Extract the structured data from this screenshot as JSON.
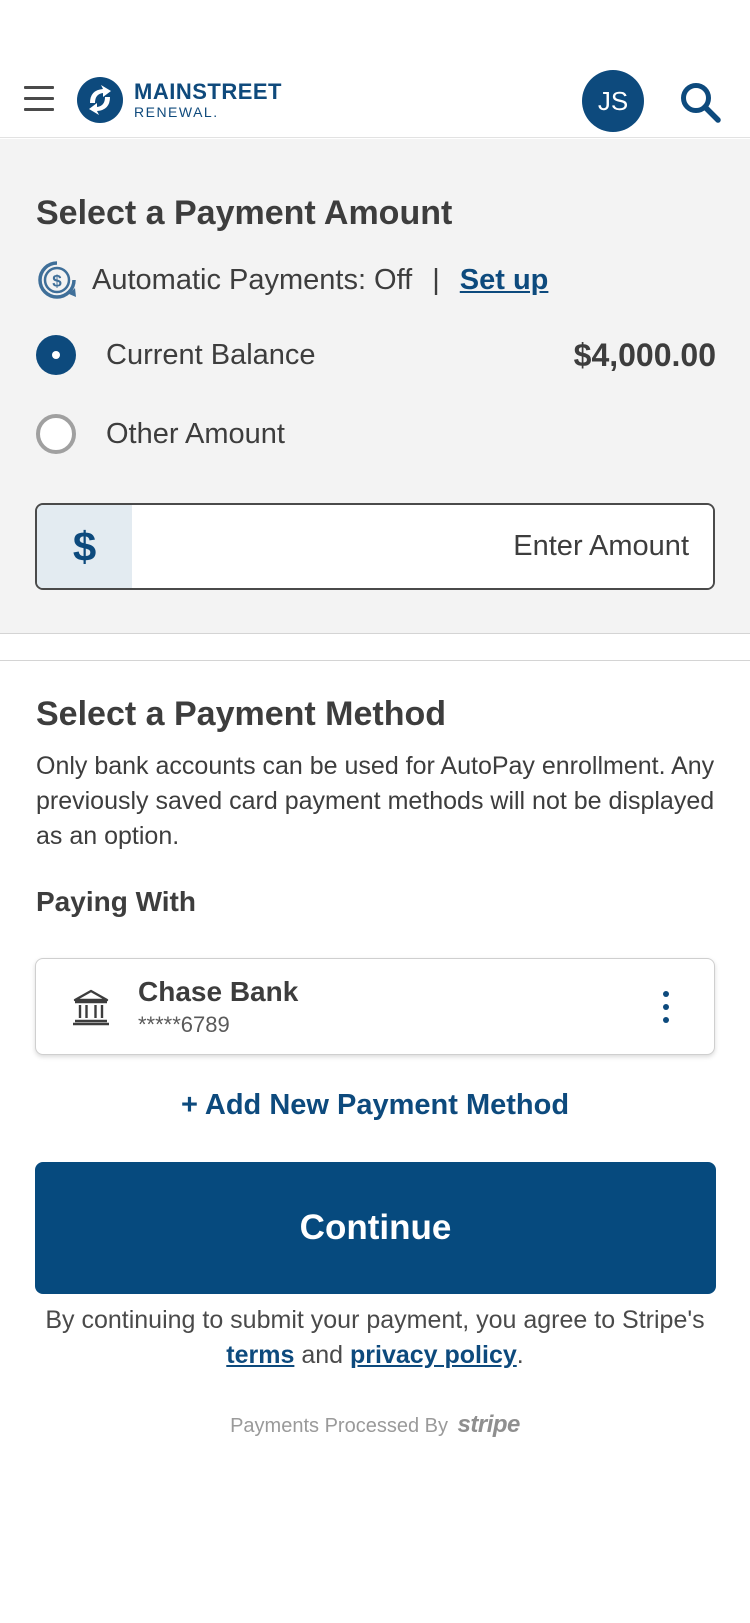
{
  "header": {
    "logo": {
      "main": "MAINSTREET",
      "sub": "RENEWAL."
    },
    "avatar_initials": "JS"
  },
  "amount_section": {
    "title": "Select a Payment Amount",
    "autopay": {
      "label": "Automatic Payments: Off",
      "separator": "|",
      "setup_link": "Set up"
    },
    "options": [
      {
        "label": "Current Balance",
        "value": "$4,000.00",
        "selected": true
      },
      {
        "label": "Other Amount",
        "selected": false
      }
    ],
    "amount_input": {
      "currency_symbol": "$",
      "placeholder": "Enter Amount"
    }
  },
  "method_section": {
    "title": "Select a Payment Method",
    "description": "Only bank accounts can be used for AutoPay enrollment. Any previously saved card payment methods will not be displayed as an option.",
    "paying_with_label": "Paying With",
    "selected_method": {
      "name": "Chase Bank",
      "account": "*****6789"
    },
    "add_method_label": "+ Add New Payment Method",
    "continue_label": "Continue",
    "legal": {
      "prefix": "By continuing to submit your payment, you agree to Stripe's",
      "terms_link": "terms",
      "and_text": "and",
      "privacy_link": "privacy policy",
      "suffix": "."
    },
    "processed_by": {
      "label": "Payments Processed By",
      "brand": "stripe"
    }
  },
  "colors": {
    "brand_blue": "#0d4a7d",
    "panel_gray": "#f3f3f3",
    "input_prefix_bg": "#e3ebf1"
  },
  "icons": [
    "hamburger-menu-icon",
    "logo-icon",
    "search-icon",
    "autopay-dollar-cycle-icon",
    "bank-icon",
    "more-options-icon"
  ]
}
